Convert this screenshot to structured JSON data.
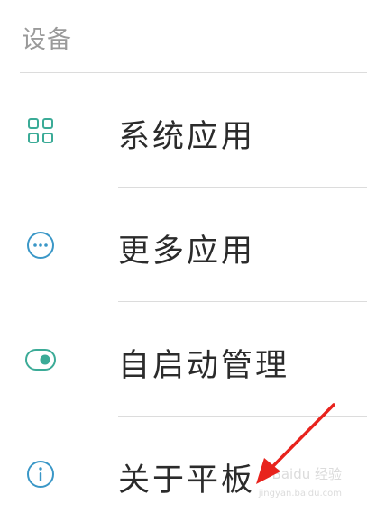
{
  "section": {
    "header": "设备"
  },
  "items": [
    {
      "label": "系统应用",
      "icon": "grid-apps-icon"
    },
    {
      "label": "更多应用",
      "icon": "more-dots-icon"
    },
    {
      "label": "自启动管理",
      "icon": "toggle-switch-icon"
    },
    {
      "label": "关于平板",
      "icon": "info-icon"
    }
  ],
  "watermark": {
    "text": "Baidu 经验",
    "url": "jingyan.baidu.com"
  },
  "colors": {
    "icon_grid": "#3bab97",
    "icon_dots": "#3a97c7",
    "icon_toggle": "#3bab97",
    "icon_info": "#3a97c7",
    "arrow": "#e8231d"
  }
}
